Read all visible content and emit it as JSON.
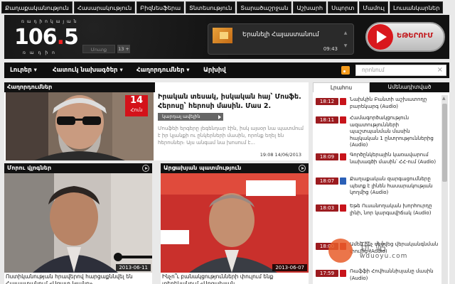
{
  "top_nav": [
    "Քաղաքականություն",
    "Հասարակություն",
    "Բիզնեսֆերա",
    "Տնտեսություն",
    "Տարածաշրջան",
    "Աշխարհ",
    "Սպորտ",
    "Մամուլ",
    "Լուսանկարներ"
  ],
  "header": {
    "logo_top": "ռ ա դ ի ո կ ա յ ա ն",
    "logo_freq_a": "106",
    "logo_freq_dot": ".",
    "logo_freq_b": "5",
    "logo_bottom": "ռ ա դ ի ո",
    "login_label": "Մուտք",
    "count": "13 +",
    "player_title": "Երանելի Հայաստանում",
    "player_time": "09:43",
    "live_label": "ԵԹԵՐՈՒՄ"
  },
  "menu": {
    "items": [
      "Լուրեր ▾",
      "Հատուկ նախագծեր ▾",
      "Հաղորդումներ ▾",
      "Արխիվ"
    ],
    "search_placeholder": "որոնում"
  },
  "feature": {
    "section": "Հաղորդումներ",
    "date_day": "14",
    "date_month": "Հուն",
    "title": "Իրական տեսակ, իսկական հայ՝ Մոսֆե. Հերոսը՝ հերոսի մասին. Մաս 2.",
    "readmore": "կարդալ ավելին",
    "text": "Մոսֆեի երգերը լեգենդար էին, իսկ այսօր նա պատմում է իր կյանքի ու ընկերների մասին, որոնք եղել են հերոսներ։ Այս անգամ նա խոսում է...",
    "date": "19:08 14/06/2013"
  },
  "video1": {
    "section": "Մորու վլոգներ",
    "date": "2013-06-11",
    "caption": "Ոստիկանության հրավերով հարցաքննվել են Հայաստանում «Ազատ Կյանք» ..."
  },
  "video2": {
    "section": "Արցախյան պատմություն",
    "date": "2013-06-07",
    "caption": "Ինչո՞ւ բանակցությունների փուլում ենք տեղեկանում «Արցախյան ..."
  },
  "sidebar": {
    "tab_active": "Լրահոս",
    "tab_inactive": "Ամենադիտված",
    "items": [
      {
        "time": "18:12",
        "icon": "red",
        "text": "Նախկին Բանտի աշխատողը բարեկարգ (Audio)"
      },
      {
        "time": "18:11",
        "icon": "red",
        "text": "Համագործակցություն ազատությունների պաշտպանման մասին հայկական 1 ընտրություններից (Audio)"
      },
      {
        "time": "18:09",
        "icon": "red",
        "text": "Գործընկերային կառավարում նախագծի մասին՝ ՀՀ-ում (Audio)"
      },
      {
        "time": "18:07",
        "icon": "blue",
        "text": "Քաղաքական զարգացումները պետք է լինեն հասարակության կողմից (Audio)"
      },
      {
        "time": "18:03",
        "icon": "red",
        "text": "Եթե Ուսանողական խորհուրդը լինի, նոր կարգավիճակ (Audio)"
      },
      {
        "time": "18:00",
        "icon": "red",
        "text": "Ամեն ինչ սկսվեց վերականգնման փուլից (Audio)"
      },
      {
        "time": "17:59",
        "icon": "red",
        "text": "Ռաֆֆի Հովհաննիսյանը մասին (Audio)"
      }
    ]
  },
  "watermark": {
    "cn": "玩 站",
    "url": "wduoyu.com"
  }
}
